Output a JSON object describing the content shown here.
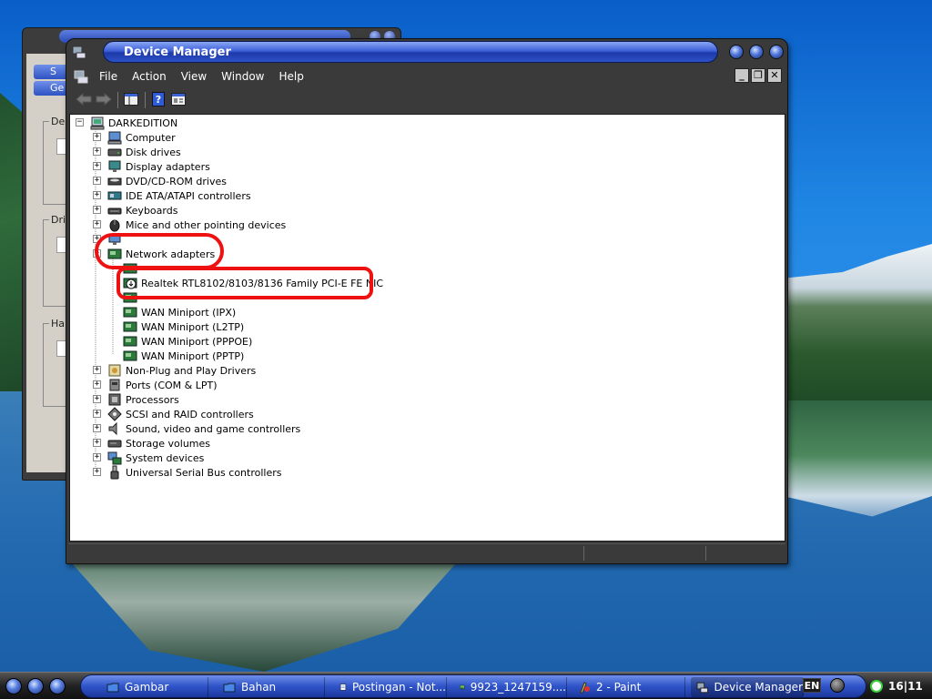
{
  "background_window": {
    "tabs": [
      "S",
      "Ge"
    ],
    "groups": [
      "De",
      "Dri",
      "Har"
    ]
  },
  "window": {
    "title": "Device Manager",
    "menu": [
      "File",
      "Action",
      "View",
      "Window",
      "Help"
    ],
    "mdi_buttons": {
      "minimize": "_",
      "restore": "❐",
      "close": "✕"
    }
  },
  "tree": {
    "root": "DARKEDITION",
    "items": [
      {
        "label": "Computer",
        "icon": "computer-icon",
        "expander": "+"
      },
      {
        "label": "Disk drives",
        "icon": "disk-drive-icon",
        "expander": "+"
      },
      {
        "label": "Display adapters",
        "icon": "display-adapter-icon",
        "expander": "+"
      },
      {
        "label": "DVD/CD-ROM drives",
        "icon": "dvd-drive-icon",
        "expander": "+"
      },
      {
        "label": "IDE ATA/ATAPI controllers",
        "icon": "ide-controller-icon",
        "expander": "+"
      },
      {
        "label": "Keyboards",
        "icon": "keyboard-icon",
        "expander": "+"
      },
      {
        "label": "Mice and other pointing devices",
        "icon": "mouse-icon",
        "expander": "+"
      },
      {
        "label": "",
        "icon": "monitor-icon",
        "expander": "+"
      },
      {
        "label": "Network adapters",
        "icon": "network-adapter-icon",
        "expander": "-"
      }
    ],
    "network_children": [
      {
        "label": "",
        "icon": "network-card-icon"
      },
      {
        "label": "Realtek RTL8102/8103/8136 Family PCI-E FE NIC",
        "icon": "network-card-warning-icon"
      },
      {
        "label": "",
        "icon": "network-card-icon"
      },
      {
        "label": "WAN Miniport (IPX)",
        "icon": "network-card-icon"
      },
      {
        "label": "WAN Miniport (L2TP)",
        "icon": "network-card-icon"
      },
      {
        "label": "WAN Miniport (PPPOE)",
        "icon": "network-card-icon"
      },
      {
        "label": "WAN Miniport (PPTP)",
        "icon": "network-card-icon"
      }
    ],
    "items_after": [
      {
        "label": "Non-Plug and Play Drivers",
        "icon": "non-pnp-icon",
        "expander": "+"
      },
      {
        "label": "Ports (COM & LPT)",
        "icon": "port-icon",
        "expander": "+"
      },
      {
        "label": "Processors",
        "icon": "processor-icon",
        "expander": "+"
      },
      {
        "label": "SCSI and RAID controllers",
        "icon": "scsi-icon",
        "expander": "+"
      },
      {
        "label": "Sound, video and game controllers",
        "icon": "sound-icon",
        "expander": "+"
      },
      {
        "label": "Storage volumes",
        "icon": "storage-volume-icon",
        "expander": "+"
      },
      {
        "label": "System devices",
        "icon": "system-device-icon",
        "expander": "+"
      },
      {
        "label": "Universal Serial Bus controllers",
        "icon": "usb-icon",
        "expander": "+"
      }
    ]
  },
  "taskbar": {
    "tasks": [
      {
        "label": "Gambar",
        "icon": "folder-icon",
        "active": false
      },
      {
        "label": "Bahan",
        "icon": "folder-icon",
        "active": false
      },
      {
        "label": "Postingan - Not...",
        "icon": "notepad-icon",
        "active": false
      },
      {
        "label": "9923_1247159....",
        "icon": "image-icon",
        "active": false
      },
      {
        "label": "2 - Paint",
        "icon": "paint-icon",
        "active": false
      },
      {
        "label": "Device Manager",
        "icon": "device-manager-icon",
        "active": true
      }
    ],
    "language": "EN",
    "clock": "16|11"
  },
  "colors": {
    "annotation": "#ee1111",
    "title_blue": "#2d52c9",
    "window_dark": "#3a3a3a"
  }
}
